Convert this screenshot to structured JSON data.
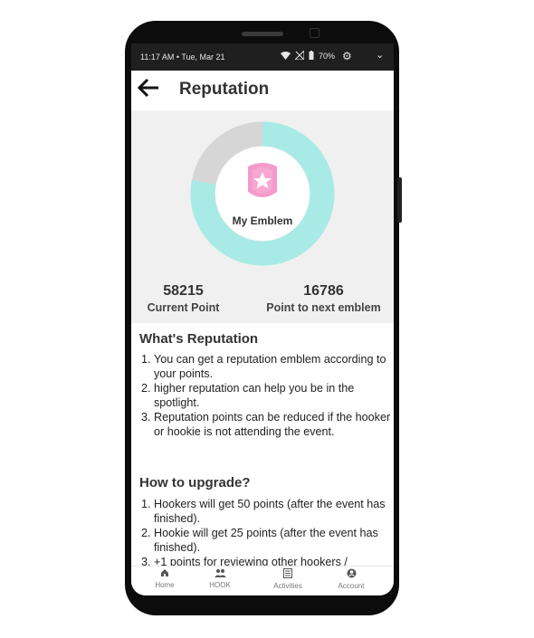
{
  "status_bar": {
    "time": "11:17 AM • Tue, Mar 21",
    "battery": "70%"
  },
  "header": {
    "title": "Reputation"
  },
  "emblem": {
    "label": "My Emblem",
    "progress_fraction": 0.78
  },
  "stats": {
    "current": {
      "value": "58215",
      "label": "Current Point"
    },
    "next": {
      "value": "16786",
      "label": "Point to next emblem"
    }
  },
  "whats_reputation": {
    "title": "What's Reputation",
    "items": [
      "You can get a reputation emblem according to your points.",
      "higher reputation can help you be in the spotlight.",
      "Reputation points can be reduced if the hooker or hookie is not attending the event."
    ]
  },
  "how_to_upgrade": {
    "title": "How to upgrade?",
    "items": [
      "Hookers will get 50 points (after the event has finished).",
      "Hookie will get 25 points (after the event has finished).",
      "+1 points for reviewing other hookers /"
    ]
  },
  "bottom_nav": [
    {
      "label": "Home",
      "icon": "home-icon"
    },
    {
      "label": "HOOK",
      "icon": "people-icon"
    },
    {
      "label": "Activities",
      "icon": "list-icon"
    },
    {
      "label": "Account",
      "icon": "account-icon"
    }
  ],
  "colors": {
    "accent": "#a8ebe6",
    "track": "#d6d6d6",
    "emblem": "#f48fc4"
  }
}
